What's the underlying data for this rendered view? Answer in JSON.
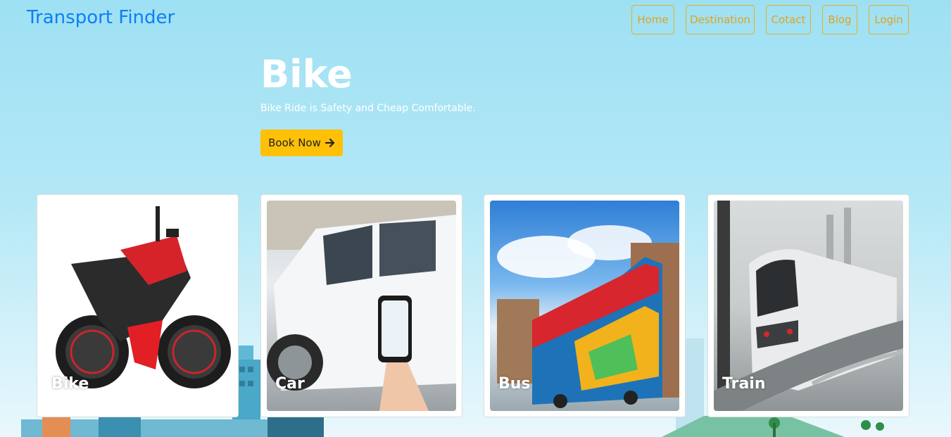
{
  "navbar": {
    "brand": "Transport Finder",
    "links": [
      {
        "label": "Home"
      },
      {
        "label": "Destination"
      },
      {
        "label": "Cotact"
      },
      {
        "label": "Blog"
      },
      {
        "label": "Login"
      }
    ]
  },
  "hero": {
    "title": "Bike",
    "subtitle": "Bike Ride is Safety and Cheap Comfortable.",
    "button_label": "Book Now",
    "button_icon": "arrow-right-icon"
  },
  "cards": [
    {
      "label": "Bike",
      "image": "motorcycle-photo"
    },
    {
      "label": "Car",
      "image": "car-photo"
    },
    {
      "label": "Bus",
      "image": "bus-photo"
    },
    {
      "label": "Train",
      "image": "train-photo"
    }
  ],
  "colors": {
    "brand": "#0d7ff5",
    "nav_border": "#e0b22a",
    "accent_button": "#ffc107",
    "background": "#9ee0f3"
  }
}
